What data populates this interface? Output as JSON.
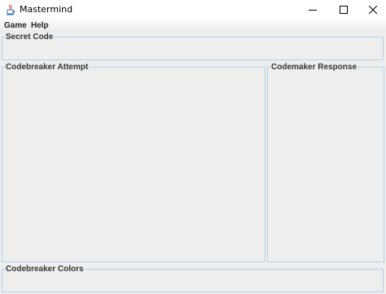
{
  "window": {
    "title": "Mastermind",
    "icon": "java-cup-icon"
  },
  "menu": {
    "items": [
      {
        "label": "Game"
      },
      {
        "label": "Help"
      }
    ]
  },
  "panels": {
    "secret_code": {
      "title": "Secret Code"
    },
    "codebreaker_attempt": {
      "title": "Codebreaker Attempt"
    },
    "codemaker_response": {
      "title": "Codemaker Response"
    },
    "codebreaker_colors": {
      "title": "Codebreaker Colors"
    }
  },
  "colors": {
    "window_background": "#eeeeee",
    "panel_border": "#b8cfe5"
  }
}
